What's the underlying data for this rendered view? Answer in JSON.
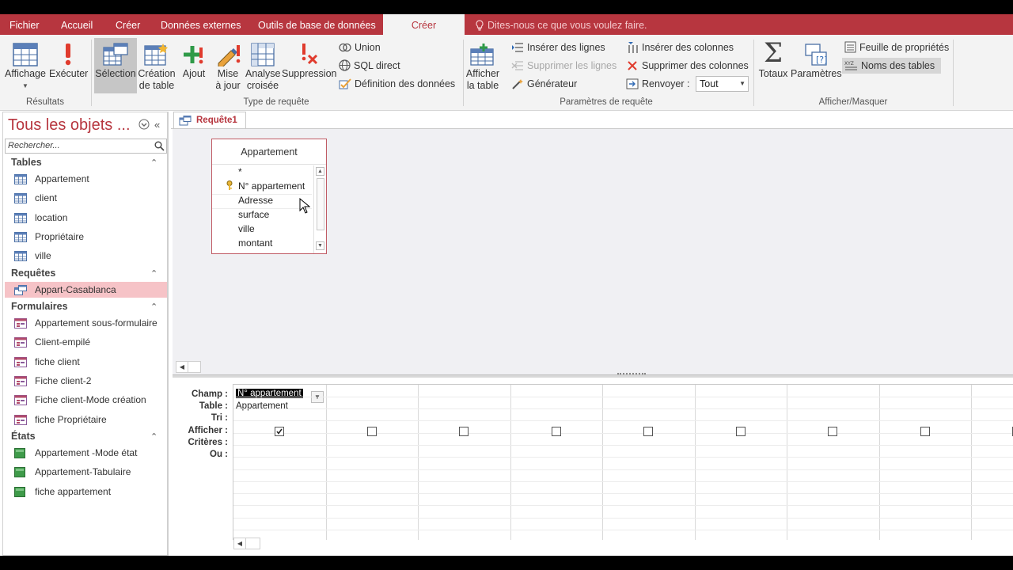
{
  "tabs": [
    "Fichier",
    "Accueil",
    "Créer",
    "Données externes",
    "Outils de base de données",
    "Créer"
  ],
  "tell_me": "Dites-nous ce que vous voulez faire.",
  "ribbon": {
    "resultats": {
      "affichage": "Affichage",
      "executer": "Exécuter",
      "group": "Résultats"
    },
    "type_requete": {
      "selection": "Sélection",
      "creation_table_1": "Création",
      "creation_table_2": "de table",
      "ajout": "Ajout",
      "mise_a_jour_1": "Mise",
      "mise_a_jour_2": "à jour",
      "analyse_1": "Analyse",
      "analyse_2": "croisée",
      "suppression": "Suppression",
      "union": "Union",
      "sql_direct": "SQL direct",
      "definition": "Définition des données",
      "group": "Type de requête"
    },
    "parametres": {
      "afficher_1": "Afficher",
      "afficher_2": "la table",
      "inserer_lignes": "Insérer des lignes",
      "supprimer_lignes": "Supprimer les lignes",
      "generateur": "Générateur",
      "inserer_colonnes": "Insérer des colonnes",
      "supprimer_colonnes": "Supprimer des colonnes",
      "renvoyer": "Renvoyer :",
      "renvoyer_value": "Tout",
      "group": "Paramètres de requête"
    },
    "afficher_masquer": {
      "totaux": "Totaux",
      "parametres": "Paramètres",
      "feuille": "Feuille de propriétés",
      "noms_tables": "Noms des tables",
      "group": "Afficher/Masquer"
    }
  },
  "nav": {
    "title": "Tous les objets ...",
    "search_placeholder": "Rechercher...",
    "sections": {
      "tables": "Tables",
      "requetes": "Requêtes",
      "formulaires": "Formulaires",
      "etats": "États"
    },
    "tables": [
      "Appartement",
      "client",
      "location",
      "Propriétaire",
      "ville"
    ],
    "requetes": [
      "Appart-Casablanca"
    ],
    "formulaires": [
      "Appartement sous-formulaire",
      "Client-empilé",
      "fiche client",
      "Fiche client-2",
      "Fiche client-Mode création",
      "fiche Propriétaire"
    ],
    "etats": [
      "Appartement -Mode état",
      "Appartement-Tabulaire",
      "fiche appartement"
    ]
  },
  "document": {
    "tab_label": "Requête1",
    "table_box": {
      "title": "Appartement",
      "fields": [
        "*",
        "N° appartement",
        "Adresse",
        "surface",
        "ville",
        "montant"
      ]
    },
    "grid": {
      "row_labels": [
        "Champ :",
        "Table :",
        "Tri :",
        "Afficher :",
        "Critères :",
        "Ou :"
      ],
      "col1_champ": "N° appartement",
      "col1_table": "Appartement"
    }
  }
}
